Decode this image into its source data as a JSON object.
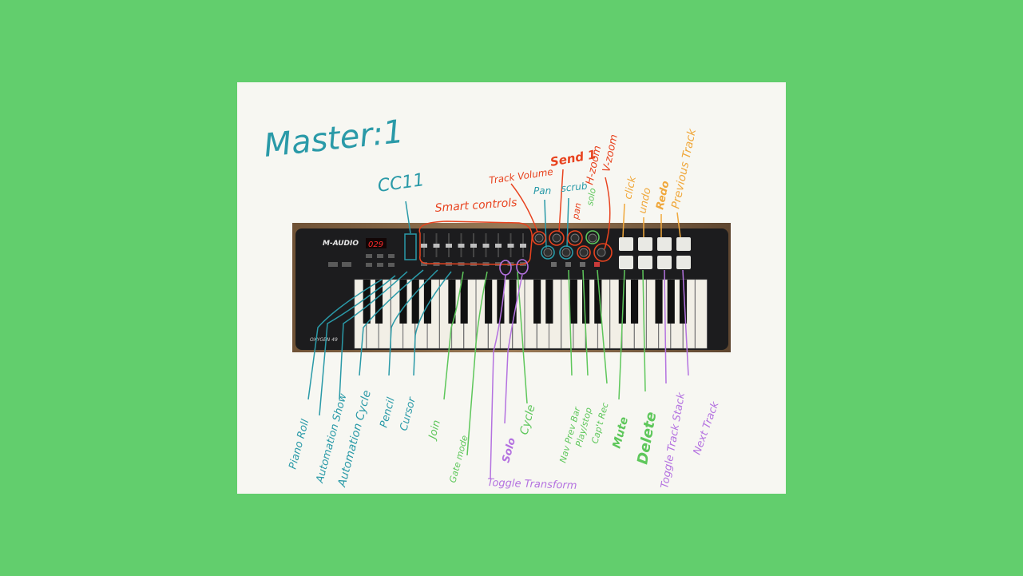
{
  "title": "Master:1",
  "device": {
    "brand": "M-AUDIO",
    "model": "OXYGEN 49",
    "display": "029"
  },
  "labels": {
    "cc11": "CC11",
    "smart_controls": "Smart controls",
    "track_volume": "Track Volume",
    "pan": "Pan",
    "send1": "Send 1",
    "scrub": "scrub",
    "h_zoom": "H-zoom",
    "v_zoom": "V-zoom",
    "pan_note": "pan",
    "solo_top": "solo",
    "click": "click",
    "undo": "undo",
    "redo": "Redo",
    "previous_track": "Previous Track",
    "piano_roll": "Piano Roll",
    "automation_show": "Automation Show",
    "automation_cycle": "Automation Cycle",
    "pencil": "Pencil",
    "cursor": "Cursor",
    "join": "Join",
    "gate_mode": "Gate mode",
    "solo": "Solo",
    "cycle": "Cycle",
    "toggle_transform": "Toggle Transform",
    "nav_prev_bar": "Nav Prev Bar",
    "play_stop": "Play/stop",
    "cap_rec": "Cap't Rec",
    "mute": "Mute",
    "delete": "Delete",
    "toggle_track_stack": "Toggle Track Stack",
    "next_track": "Next Track"
  },
  "colors": {
    "background": "#62ce6d",
    "paper": "#f7f7f2",
    "teal": "#2a9aa8",
    "red": "#e8431f",
    "orange": "#f0a83c",
    "green": "#5ec75b",
    "purple": "#b472e0",
    "wood": "#8a6a4a",
    "keyboard_body": "#1c1c1e"
  }
}
